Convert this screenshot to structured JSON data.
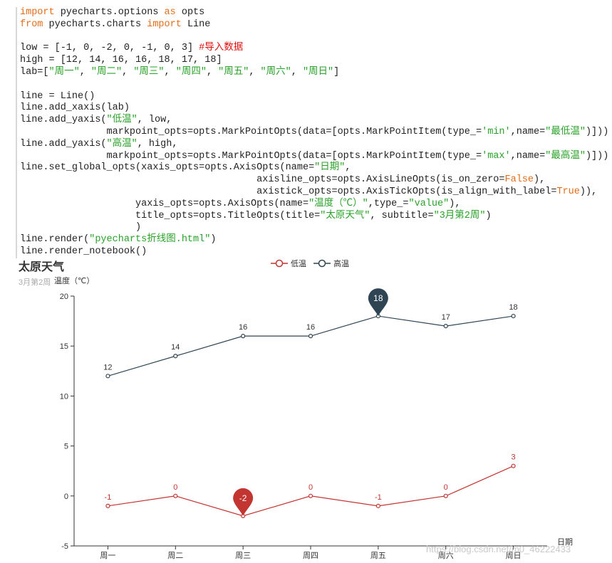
{
  "code": {
    "lines": [
      [
        {
          "t": "import",
          "c": "kw"
        },
        {
          "t": " pyecharts.options ",
          "c": ""
        },
        {
          "t": "as",
          "c": "kw"
        },
        {
          "t": " opts",
          "c": ""
        }
      ],
      [
        {
          "t": "from",
          "c": "kw"
        },
        {
          "t": " pyecharts.charts ",
          "c": ""
        },
        {
          "t": "import",
          "c": "kw"
        },
        {
          "t": " Line",
          "c": ""
        }
      ],
      [],
      [
        {
          "t": "low = [-1, 0, -2, 0, -1, 0, 3] ",
          "c": ""
        },
        {
          "t": "#导入数据",
          "c": "cm"
        }
      ],
      [
        {
          "t": "high = [12, 14, 16, 16, 18, 17, 18]",
          "c": ""
        }
      ],
      [
        {
          "t": "lab=[",
          "c": ""
        },
        {
          "t": "\"周一\"",
          "c": "str"
        },
        {
          "t": ", ",
          "c": ""
        },
        {
          "t": "\"周二\"",
          "c": "str"
        },
        {
          "t": ", ",
          "c": ""
        },
        {
          "t": "\"周三\"",
          "c": "str"
        },
        {
          "t": ", ",
          "c": ""
        },
        {
          "t": "\"周四\"",
          "c": "str"
        },
        {
          "t": ", ",
          "c": ""
        },
        {
          "t": "\"周五\"",
          "c": "str"
        },
        {
          "t": ", ",
          "c": ""
        },
        {
          "t": "\"周六\"",
          "c": "str"
        },
        {
          "t": ", ",
          "c": ""
        },
        {
          "t": "\"周日\"",
          "c": "str"
        },
        {
          "t": "]",
          "c": ""
        }
      ],
      [],
      [
        {
          "t": "line = Line()",
          "c": ""
        }
      ],
      [
        {
          "t": "line.add_xaxis(lab)",
          "c": ""
        }
      ],
      [
        {
          "t": "line.add_yaxis(",
          "c": ""
        },
        {
          "t": "\"低温\"",
          "c": "str"
        },
        {
          "t": ", low,",
          "c": ""
        }
      ],
      [
        {
          "t": "               markpoint_opts=opts.MarkPointOpts(data=[opts.MarkPointItem(type_=",
          "c": ""
        },
        {
          "t": "'min'",
          "c": "str"
        },
        {
          "t": ",name=",
          "c": ""
        },
        {
          "t": "\"最低温\"",
          "c": "str"
        },
        {
          "t": ")]))",
          "c": ""
        }
      ],
      [
        {
          "t": "line.add_yaxis(",
          "c": ""
        },
        {
          "t": "\"高温\"",
          "c": "str"
        },
        {
          "t": ", high,",
          "c": ""
        }
      ],
      [
        {
          "t": "               markpoint_opts=opts.MarkPointOpts(data=[opts.MarkPointItem(type_=",
          "c": ""
        },
        {
          "t": "'max'",
          "c": "str"
        },
        {
          "t": ",name=",
          "c": ""
        },
        {
          "t": "\"最高温\"",
          "c": "str"
        },
        {
          "t": ")]))",
          "c": ""
        }
      ],
      [
        {
          "t": "line.set_global_opts(xaxis_opts=opts.AxisOpts(name=",
          "c": ""
        },
        {
          "t": "\"日期\"",
          "c": "str"
        },
        {
          "t": ",",
          "c": ""
        }
      ],
      [
        {
          "t": "                                         axisline_opts=opts.AxisLineOpts(is_on_zero=",
          "c": ""
        },
        {
          "t": "False",
          "c": "lit"
        },
        {
          "t": "),",
          "c": ""
        }
      ],
      [
        {
          "t": "                                         axistick_opts=opts.AxisTickOpts(is_align_with_label=",
          "c": ""
        },
        {
          "t": "True",
          "c": "lit"
        },
        {
          "t": ")),",
          "c": ""
        }
      ],
      [
        {
          "t": "                    yaxis_opts=opts.AxisOpts(name=",
          "c": ""
        },
        {
          "t": "\"温度（℃）\"",
          "c": "str"
        },
        {
          "t": ",type_=",
          "c": ""
        },
        {
          "t": "\"value\"",
          "c": "str"
        },
        {
          "t": "),",
          "c": ""
        }
      ],
      [
        {
          "t": "                    title_opts=opts.TitleOpts(title=",
          "c": ""
        },
        {
          "t": "\"太原天气\"",
          "c": "str"
        },
        {
          "t": ", subtitle=",
          "c": ""
        },
        {
          "t": "\"3月第2周\"",
          "c": "str"
        },
        {
          "t": ")",
          "c": ""
        }
      ],
      [
        {
          "t": "                    )",
          "c": ""
        }
      ],
      [
        {
          "t": "line.render(",
          "c": ""
        },
        {
          "t": "\"pyecharts折线图.html\"",
          "c": "str"
        },
        {
          "t": ")",
          "c": ""
        }
      ],
      [
        {
          "t": "line.render_notebook()",
          "c": ""
        }
      ]
    ]
  },
  "chart_data": {
    "type": "line",
    "title": "太原天气",
    "subtitle": "3月第2周",
    "xlabel": "日期",
    "ylabel": "温度（℃）",
    "categories": [
      "周一",
      "周二",
      "周三",
      "周四",
      "周五",
      "周六",
      "周日"
    ],
    "ylim": [
      -5,
      20
    ],
    "yticks": [
      -5,
      0,
      5,
      10,
      15,
      20
    ],
    "grid": false,
    "legend_position": "top-center",
    "series": [
      {
        "name": "低温",
        "values": [
          -1,
          0,
          -2,
          0,
          -1,
          0,
          3
        ],
        "color": "#c23531",
        "markpoint": "min"
      },
      {
        "name": "高温",
        "values": [
          12,
          14,
          16,
          16,
          18,
          17,
          18
        ],
        "color": "#2f4554",
        "markpoint": "max"
      }
    ]
  },
  "watermark": "https://blog.csdn.net/m0_46222433"
}
